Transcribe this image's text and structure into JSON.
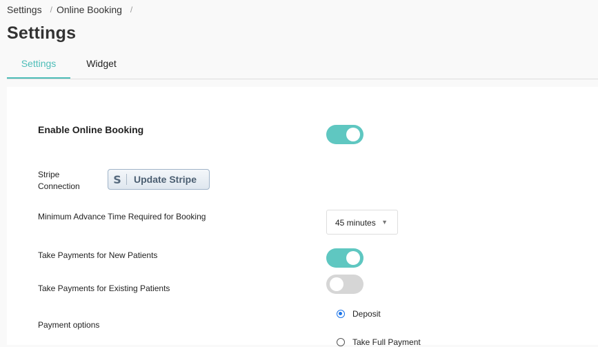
{
  "breadcrumb": {
    "items": [
      "Settings",
      "Online Booking"
    ],
    "separator": "/"
  },
  "page_title": "Settings",
  "tabs": [
    {
      "label": "Settings",
      "active": true
    },
    {
      "label": "Widget",
      "active": false
    }
  ],
  "online_booking": {
    "enable_label": "Enable Online Booking",
    "enable_on": true,
    "stripe_label_line1": "Stripe",
    "stripe_label_line2": "Connection",
    "stripe_button_icon": "S",
    "stripe_button_label": "Update Stripe",
    "min_advance_label": "Minimum Advance Time Required for Booking",
    "min_advance_value": "45 minutes",
    "new_patients_label": "Take Payments for New Patients",
    "new_patients_on": true,
    "existing_patients_label": "Take Payments for Existing Patients",
    "existing_patients_on": false,
    "payment_options_label": "Payment options",
    "payment_options": [
      {
        "label": "Deposit",
        "selected": true
      },
      {
        "label": "Take Full Payment",
        "selected": false
      }
    ]
  },
  "colors": {
    "accent": "#4dbdb8",
    "toggle_on": "#5fc7c1",
    "toggle_off": "#d6d6d6",
    "radio_selected": "#1a73e8"
  },
  "icons": {
    "stripe": "stripe-s-icon",
    "dropdown": "caret-down-icon"
  }
}
